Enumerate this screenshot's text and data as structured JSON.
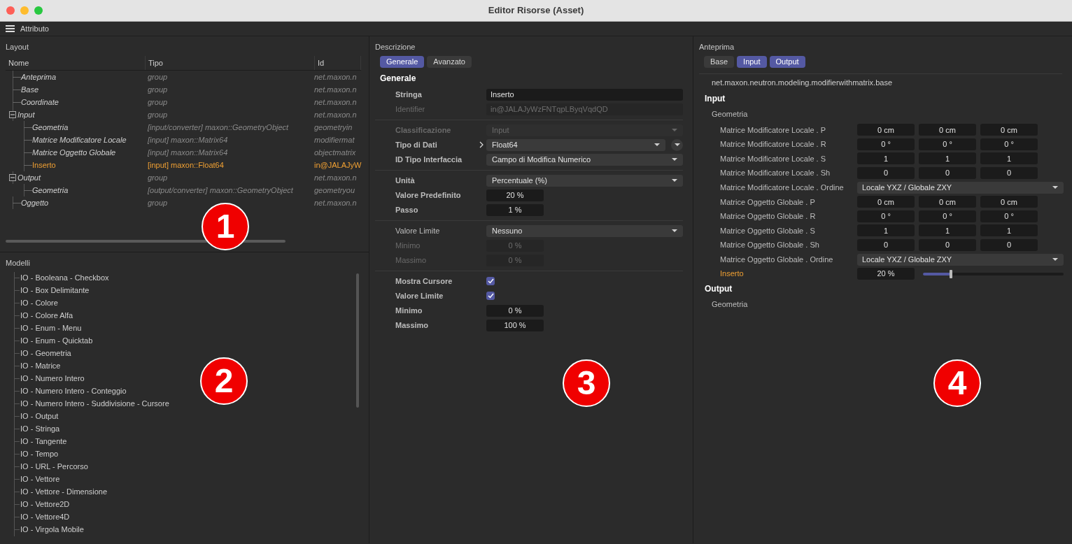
{
  "window": {
    "title": "Editor Risorse (Asset)"
  },
  "toolbar": {
    "label": "Attributo"
  },
  "layout": {
    "title": "Layout",
    "columns": [
      "Nome",
      "Tipo",
      "Id"
    ],
    "callout": "1",
    "rows": [
      {
        "name": "Anteprima",
        "type": "group",
        "id": "net.maxon.n",
        "selected": false
      },
      {
        "name": "Base",
        "type": "group",
        "id": "net.maxon.n",
        "selected": false
      },
      {
        "name": "Coordinate",
        "type": "group",
        "id": "net.maxon.n",
        "selected": false
      },
      {
        "name": "Input",
        "type": "group",
        "id": "net.maxon.n",
        "selected": false,
        "expanded": true,
        "children": [
          {
            "name": "Geometria",
            "type": "[input/converter] maxon::GeometryObject",
            "id": "geometryin",
            "selected": false
          },
          {
            "name": "Matrice Modificatore Locale",
            "type": "[input] maxon::Matrix64",
            "id": "modifiermat",
            "selected": false
          },
          {
            "name": "Matrice Oggetto Globale",
            "type": "[input] maxon::Matrix64",
            "id": "objectmatrix",
            "selected": false
          },
          {
            "name": "Inserto",
            "type": "[input] maxon::Float64",
            "id": "in@JALAJyW",
            "selected": true
          }
        ]
      },
      {
        "name": "Output",
        "type": "group",
        "id": "net.maxon.n",
        "selected": false,
        "expanded": true,
        "children": [
          {
            "name": "Geometria",
            "type": "[output/converter] maxon::GeometryObject",
            "id": "geometryou",
            "selected": false
          }
        ]
      },
      {
        "name": "Oggetto",
        "type": "group",
        "id": "net.maxon.n",
        "selected": false
      }
    ]
  },
  "models": {
    "title": "Modelli",
    "callout": "2",
    "items": [
      "IO - Booleana - Checkbox",
      "IO - Box Delimitante",
      "IO - Colore",
      "IO - Colore Alfa",
      "IO - Enum - Menu",
      "IO - Enum - Quicktab",
      "IO - Geometria",
      "IO - Matrice",
      "IO - Numero Intero",
      "IO - Numero Intero - Conteggio",
      "IO - Numero Intero - Suddivisione - Cursore",
      "IO - Output",
      "IO - Stringa",
      "IO - Tangente",
      "IO - Tempo",
      "IO - URL - Percorso",
      "IO - Vettore",
      "IO - Vettore - Dimensione",
      "IO - Vettore2D",
      "IO - Vettore4D",
      "IO - Virgola Mobile"
    ]
  },
  "description": {
    "title": "Descrizione",
    "callout": "3",
    "tabs": [
      {
        "label": "Generale",
        "selected": true
      },
      {
        "label": "Avanzato",
        "selected": false
      }
    ],
    "heading": "Generale",
    "groups": [
      [
        {
          "kind": "text",
          "label": "Stringa",
          "value": "Inserto",
          "bold": true,
          "disabled": false
        },
        {
          "kind": "text",
          "label": "Identifier",
          "value": "in@JALAJyWzFNTqpLByqVqdQD",
          "bold": false,
          "disabled": true
        }
      ],
      [
        {
          "kind": "dropdown",
          "label": "Classificazione",
          "value": "Input",
          "bold": true,
          "disabled": true
        },
        {
          "kind": "dropdown",
          "label": "Tipo di Dati",
          "value": "Float64",
          "bold": true,
          "disabled": false,
          "expander": true,
          "menu_button": true
        },
        {
          "kind": "dropdown",
          "label": "ID Tipo Interfaccia",
          "value": "Campo di Modifica Numerico",
          "bold": true,
          "disabled": false
        }
      ],
      [
        {
          "kind": "dropdown",
          "label": "Unità",
          "value": "Percentuale (%)",
          "bold": true,
          "disabled": false
        },
        {
          "kind": "number",
          "label": "Valore Predefinito",
          "value": "20 %",
          "bold": true,
          "disabled": false
        },
        {
          "kind": "number",
          "label": "Passo",
          "value": "1 %",
          "bold": true,
          "disabled": false
        }
      ],
      [
        {
          "kind": "dropdown",
          "label": "Valore Limite",
          "value": "Nessuno",
          "bold": false,
          "disabled": false
        },
        {
          "kind": "number",
          "label": "Minimo",
          "value": "0 %",
          "bold": false,
          "disabled": true
        },
        {
          "kind": "number",
          "label": "Massimo",
          "value": "0 %",
          "bold": false,
          "disabled": true
        }
      ],
      [
        {
          "kind": "checkbox",
          "label": "Mostra Cursore",
          "checked": true,
          "bold": true,
          "disabled": false
        },
        {
          "kind": "checkbox",
          "label": "Valore Limite",
          "checked": true,
          "bold": true,
          "disabled": false
        },
        {
          "kind": "number",
          "label": "Minimo",
          "value": "0 %",
          "bold": true,
          "disabled": false
        },
        {
          "kind": "number",
          "label": "Massimo",
          "value": "100 %",
          "bold": true,
          "disabled": false
        }
      ]
    ]
  },
  "preview": {
    "title": "Anteprima",
    "callout": "4",
    "tabs": [
      {
        "label": "Base",
        "selected": false
      },
      {
        "label": "Input",
        "selected": true
      },
      {
        "label": "Output",
        "selected": true
      }
    ],
    "path": "net.maxon.neutron.modeling.modifierwithmatrix.base",
    "sections": [
      {
        "heading": "Input",
        "groups": [
          {
            "label": "Geometria",
            "rows": [
              {
                "kind": "vector",
                "label": "Matrice Modificatore Locale . P",
                "values": [
                  "0 cm",
                  "0 cm",
                  "0 cm"
                ],
                "highlighted": false
              },
              {
                "kind": "vector",
                "label": "Matrice Modificatore Locale . R",
                "values": [
                  "0 °",
                  "0 °",
                  "0 °"
                ],
                "highlighted": false
              },
              {
                "kind": "vector",
                "label": "Matrice Modificatore Locale . S",
                "values": [
                  "1",
                  "1",
                  "1"
                ],
                "highlighted": false
              },
              {
                "kind": "vector",
                "label": "Matrice Modificatore Locale . Sh",
                "values": [
                  "0",
                  "0",
                  "0"
                ],
                "highlighted": false
              },
              {
                "kind": "dropdown",
                "label": "Matrice Modificatore Locale . Ordine",
                "value": "Locale YXZ / Globale ZXY",
                "highlighted": false
              },
              {
                "kind": "vector",
                "label": "Matrice Oggetto Globale . P",
                "values": [
                  "0 cm",
                  "0 cm",
                  "0 cm"
                ],
                "highlighted": false
              },
              {
                "kind": "vector",
                "label": "Matrice Oggetto Globale . R",
                "values": [
                  "0 °",
                  "0 °",
                  "0 °"
                ],
                "highlighted": false
              },
              {
                "kind": "vector",
                "label": "Matrice Oggetto Globale . S",
                "values": [
                  "1",
                  "1",
                  "1"
                ],
                "highlighted": false
              },
              {
                "kind": "vector",
                "label": "Matrice Oggetto Globale . Sh",
                "values": [
                  "0",
                  "0",
                  "0"
                ],
                "highlighted": false
              },
              {
                "kind": "dropdown",
                "label": "Matrice Oggetto Globale . Ordine",
                "value": "Locale YXZ / Globale ZXY",
                "highlighted": false
              },
              {
                "kind": "slider",
                "label": "Inserto",
                "value": "20 %",
                "level": 0.2,
                "highlighted": true
              }
            ]
          }
        ]
      },
      {
        "heading": "Output",
        "groups": [
          {
            "label": "Geometria"
          }
        ]
      }
    ]
  }
}
